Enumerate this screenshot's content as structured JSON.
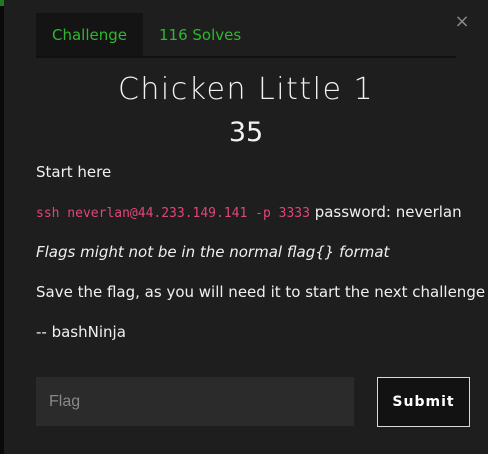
{
  "tabs": [
    {
      "label": "Challenge",
      "active": true
    },
    {
      "label": "116 Solves",
      "active": false
    }
  ],
  "close_label": "×",
  "challenge": {
    "name": "Chicken Little 1",
    "points": "35",
    "description": {
      "start": "Start here",
      "command": "ssh neverlan@44.233.149.141 -p 3333",
      "password": " password: neverlan",
      "note": "Flags might not be in the normal flag{} format",
      "instruction": "Save the flag, as you will need it to start the next challenge",
      "signature": "-- bashNinja"
    }
  },
  "form": {
    "flag_placeholder": "Flag",
    "flag_value": "",
    "submit_label": "Submit"
  },
  "colors": {
    "accent": "#2db82d",
    "code": "#e0457b",
    "background": "#1e1e1e"
  }
}
